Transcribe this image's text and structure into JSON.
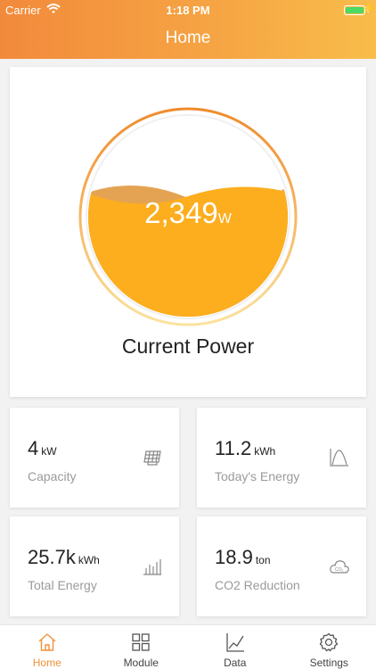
{
  "status_bar": {
    "carrier": "Carrier",
    "time": "1:18 PM"
  },
  "header": {
    "title": "Home"
  },
  "current_power": {
    "value": "2,349",
    "unit": "W",
    "label": "Current Power",
    "fill_fraction": 0.52
  },
  "stats": [
    {
      "value": "4",
      "unit": "kW",
      "label": "Capacity",
      "icon": "solar-panel-icon"
    },
    {
      "value": "11.2",
      "unit": "kWh",
      "label": "Today's Energy",
      "icon": "curve-icon"
    },
    {
      "value": "25.7k",
      "unit": "kWh",
      "label": "Total Energy",
      "icon": "bar-chart-icon"
    },
    {
      "value": "18.9",
      "unit": "ton",
      "label": "CO2 Reduction",
      "icon": "co2-cloud-icon"
    }
  ],
  "tabs": [
    {
      "label": "Home",
      "icon": "home-icon",
      "active": true
    },
    {
      "label": "Module",
      "icon": "grid-icon",
      "active": false
    },
    {
      "label": "Data",
      "icon": "line-chart-icon",
      "active": false
    },
    {
      "label": "Settings",
      "icon": "gear-icon",
      "active": false
    }
  ],
  "colors": {
    "accent": "#f0913a",
    "header_start": "#f28a3c",
    "header_end": "#f8bd4a",
    "gauge_fill": "#fcae1e",
    "positive": "#4cd964"
  }
}
